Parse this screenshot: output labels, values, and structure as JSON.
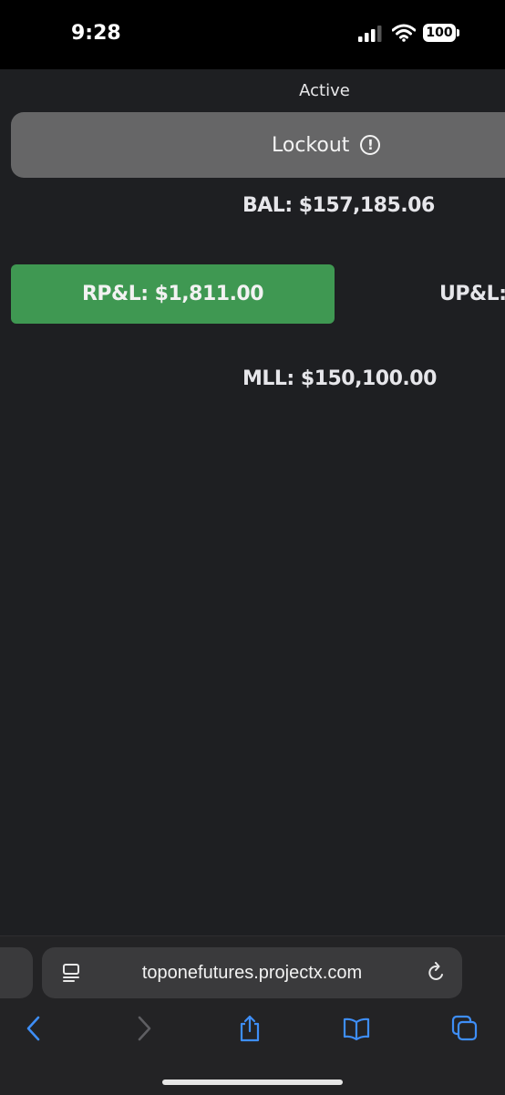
{
  "status_bar": {
    "time": "9:28",
    "battery": "100",
    "icons": [
      "cellular-signal-icon",
      "wifi-icon",
      "battery-icon"
    ]
  },
  "account": {
    "status": "Active",
    "lockout_label": "Lockout",
    "lockout_icon": "exclamation-circle-icon",
    "balance": "BAL: $157,185.06",
    "realized_pnl": "RP&L: $1,811.00",
    "unrealized_pnl_partial": "UP&L: $",
    "max_loss_limit": "MLL: $150,100.00"
  },
  "browser": {
    "url": "toponefutures.projectx.com",
    "toolbar": [
      "back-icon",
      "forward-icon",
      "share-icon",
      "bookmarks-icon",
      "tabs-icon"
    ]
  },
  "colors": {
    "background": "#1e1f22",
    "lockout_button": "#666667",
    "rpl_button": "#3f9852",
    "accent_blue": "#3e8ef7"
  }
}
